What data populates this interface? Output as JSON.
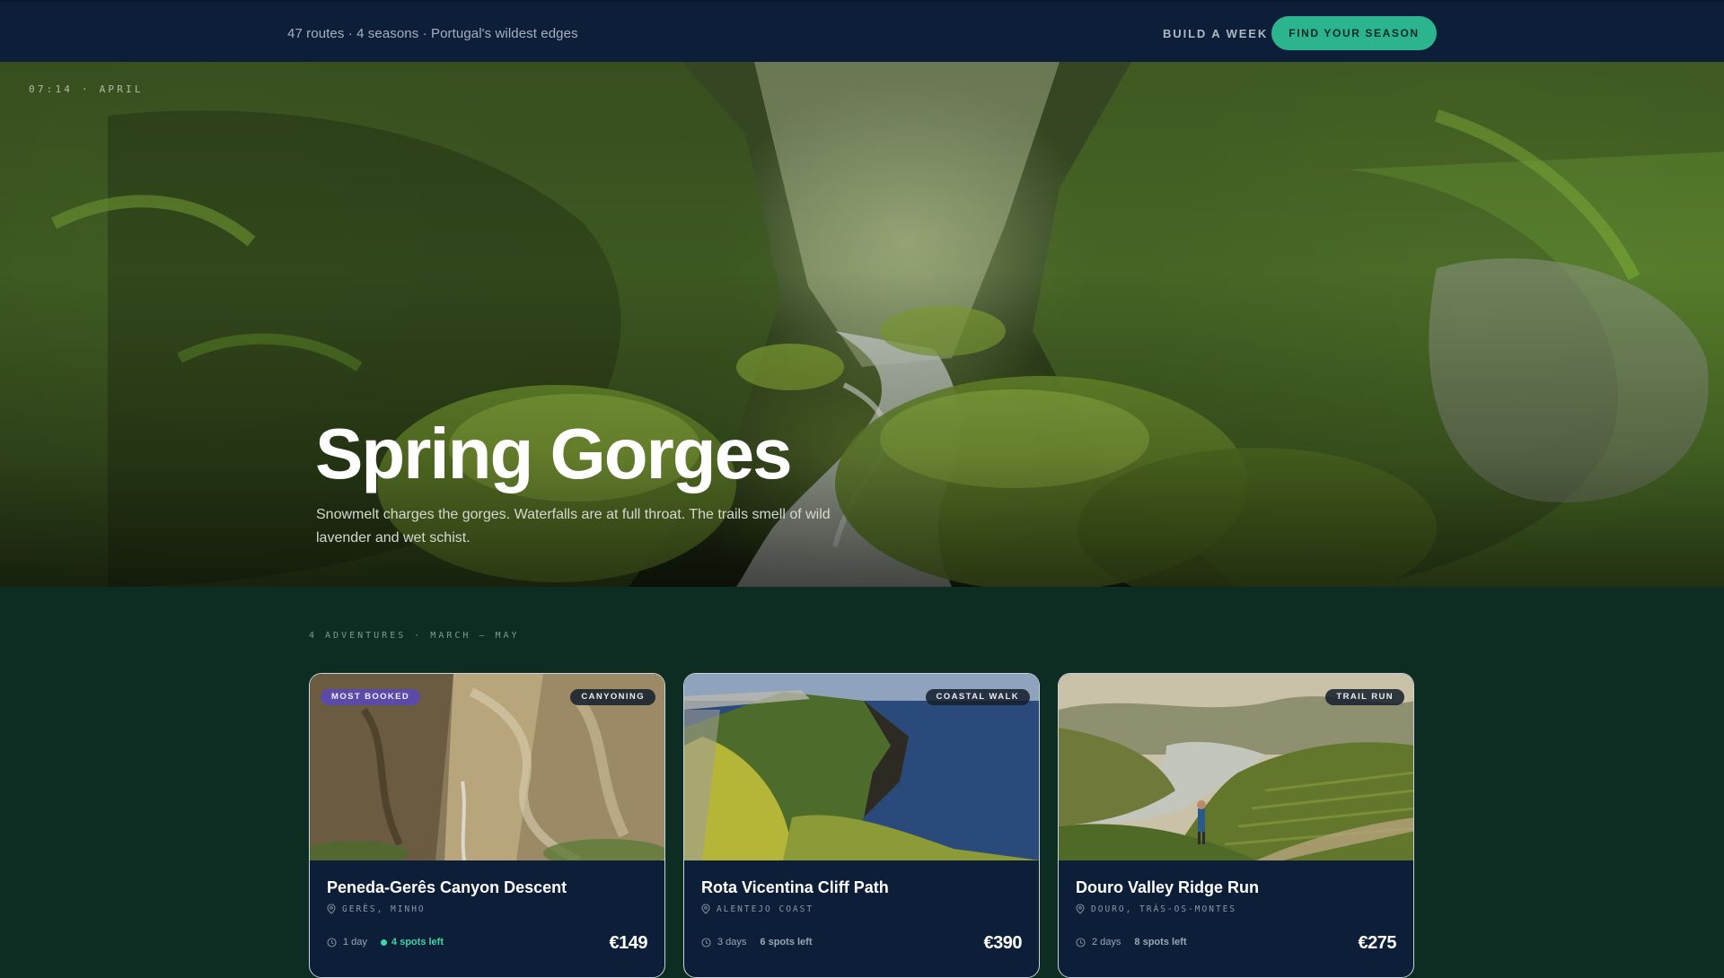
{
  "topbar": {
    "tagline": "47 routes · 4 seasons · Portugal's wildest edges",
    "build_link": "BUILD A WEEK",
    "cta_label": "FIND YOUR SEASON",
    "accent_color": "#2cb48e"
  },
  "hero": {
    "timestamp": "07:14 · APRIL",
    "title": "Spring Gorges",
    "description": "Snowmelt charges the gorges. Waterfalls are at full throat. The trails smell of wild lavender and wet schist."
  },
  "adventures": {
    "section_label": "4 ADVENTURES · MARCH — MAY",
    "cards": [
      {
        "badge_hot": "MOST BOOKED",
        "type": "CANYONING",
        "title": "Peneda-Gerês Canyon Descent",
        "location": "GERÊS, MINHO",
        "duration": "1 day",
        "spots": "4 spots left",
        "price": "€149"
      },
      {
        "type": "COASTAL WALK",
        "title": "Rota Vicentina Cliff Path",
        "location": "ALENTEJO COAST",
        "duration": "3 days",
        "spots": "6 spots left",
        "price": "€390"
      },
      {
        "type": "TRAIL RUN",
        "title": "Douro Valley Ridge Run",
        "location": "DOURO, TRÁS-OS-MONTES",
        "duration": "2 days",
        "spots": "8 spots left",
        "price": "€275"
      }
    ]
  }
}
